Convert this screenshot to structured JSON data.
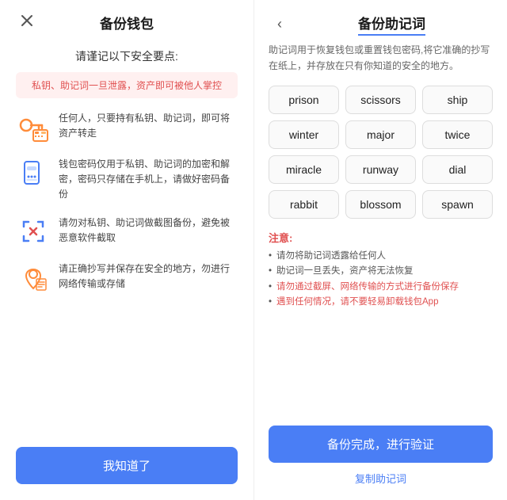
{
  "left": {
    "title": "备份钱包",
    "subtitle": "请谨记以下安全要点:",
    "warning": "私钥、助记词一旦泄露，资产即可被他人掌控",
    "close_label": "×",
    "security_items": [
      {
        "id": "item1",
        "icon": "key-calc-icon",
        "text": "任何人，只要持有私钥、助记词，即可将资产转走"
      },
      {
        "id": "item2",
        "icon": "phone-dots-icon",
        "text": "钱包密码仅用于私钥、助记词的加密和解密，密码只存储在手机上，请做好密码备份"
      },
      {
        "id": "item3",
        "icon": "scan-x-icon",
        "text": "请勿对私钥、助记词做截图备份，避免被恶意软件截取"
      },
      {
        "id": "item4",
        "icon": "location-icon",
        "text": "请正确抄写并保存在安全的地方，勿进行网络传输或存储"
      }
    ],
    "button_label": "我知道了"
  },
  "right": {
    "title": "备份助记词",
    "back_label": "‹",
    "desc": "助记词用于恢复钱包或重置钱包密码,将它准确的抄写在纸上，并存放在只有你知道的安全的地方。",
    "words": [
      "prison",
      "scissors",
      "ship",
      "winter",
      "major",
      "twice",
      "miracle",
      "runway",
      "dial",
      "rabbit",
      "blossom",
      "spawn"
    ],
    "notes_title": "注意:",
    "notes": [
      {
        "text": "请勿将助记词透露给任何人",
        "red": false
      },
      {
        "text": "助记词一旦丢失，资产将无法恢复",
        "red": false
      },
      {
        "text": "请勿通过截屏、网络传输的方式进行备份保存",
        "red": true
      },
      {
        "text": "遇到任何情况，请不要轻易卸载钱包App",
        "red": true
      }
    ],
    "confirm_button": "备份完成，进行验证",
    "copy_label": "复制助记词"
  }
}
